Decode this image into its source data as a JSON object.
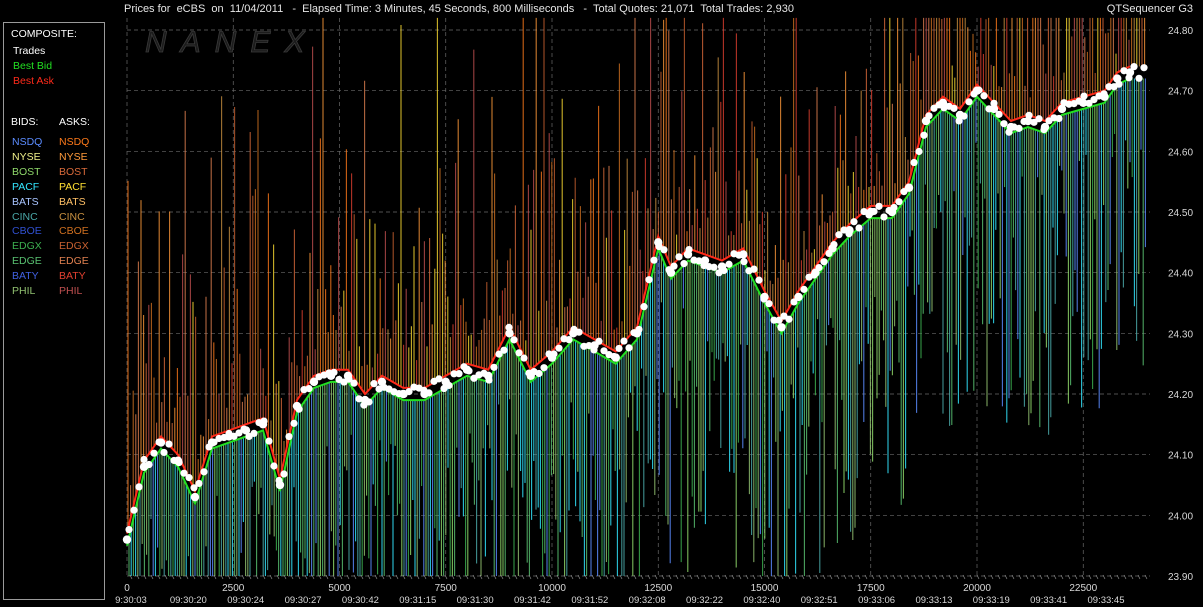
{
  "header": {
    "title": "Prices for  eCBS  on  11/04/2011   -  Elapsed Time: 3 Minutes, 45 Seconds, 800 Milliseconds   -  Total Quotes: 21,071  Total Trades: 2,930",
    "product": "QTSequencer G3",
    "watermark": "NANEX"
  },
  "legend": {
    "composite_title": "COMPOSITE:",
    "composite": [
      {
        "label": "Trades",
        "color": "#ffffff"
      },
      {
        "label": "Best Bid",
        "color": "#22e022"
      },
      {
        "label": "Best Ask",
        "color": "#ff2a1a"
      }
    ],
    "bids_title": "BIDS:",
    "asks_title": "ASKS:",
    "exchanges": [
      {
        "bid": "NSDQ",
        "ask": "NSDQ",
        "bid_color": "#5b8cff",
        "ask_color": "#ff7a1a"
      },
      {
        "bid": "NYSE",
        "ask": "NYSE",
        "bid_color": "#f0f08a",
        "ask_color": "#ff9a3a"
      },
      {
        "bid": "BOST",
        "ask": "BOST",
        "bid_color": "#8fd86a",
        "ask_color": "#d96a3a"
      },
      {
        "bid": "PACF",
        "ask": "PACF",
        "bid_color": "#33e6ff",
        "ask_color": "#ffe033"
      },
      {
        "bid": "BATS",
        "ask": "BATS",
        "bid_color": "#a8c4ff",
        "ask_color": "#ffc066"
      },
      {
        "bid": "CINC",
        "ask": "CINC",
        "bid_color": "#4aa8a8",
        "ask_color": "#c89040"
      },
      {
        "bid": "CBOE",
        "ask": "CBOE",
        "bid_color": "#3050d0",
        "ask_color": "#d07020"
      },
      {
        "bid": "EDGX",
        "ask": "EDGX",
        "bid_color": "#3cb050",
        "ask_color": "#c86030"
      },
      {
        "bid": "EDGE",
        "ask": "EDGE",
        "bid_color": "#58c070",
        "ask_color": "#e08050"
      },
      {
        "bid": "BATY",
        "ask": "BATY",
        "bid_color": "#4060e0",
        "ask_color": "#e04030"
      },
      {
        "bid": "PHIL",
        "ask": "PHIL",
        "bid_color": "#90c070",
        "ask_color": "#c05050"
      }
    ]
  },
  "chart_data": {
    "type": "line",
    "title": "Prices for  eCBS  on  11/04/2011",
    "ylim": [
      23.9,
      24.8
    ],
    "y_ticks": [
      "24.80",
      "24.70",
      "24.60",
      "24.50",
      "24.40",
      "24.30",
      "24.20",
      "24.10",
      "24.00",
      "23.90"
    ],
    "xlim": [
      0,
      24000
    ],
    "x_ticks": [
      "0",
      "2500",
      "5000",
      "7500",
      "10000",
      "12500",
      "15000",
      "17500",
      "20000",
      "22500"
    ],
    "time_ticks": [
      "9:30:03",
      "09:30:20",
      "09:30:24",
      "09:30:27",
      "09:30:42",
      "09:31:15",
      "09:31:30",
      "09:31:42",
      "09:31:52",
      "09:32:08",
      "09:32:22",
      "09:32:40",
      "09:32:51",
      "09:33:06",
      "09:33:13",
      "09:33:19",
      "09:33:41",
      "09:33:45"
    ],
    "grid": true,
    "series": [
      {
        "name": "Trades",
        "color": "#ffffff",
        "x": [
          0,
          400,
          800,
          1200,
          1600,
          2000,
          2400,
          2800,
          3200,
          3600,
          4000,
          4400,
          4800,
          5200,
          5600,
          6000,
          6500,
          7000,
          7500,
          8000,
          8500,
          9000,
          9500,
          10000,
          10500,
          11000,
          11500,
          12000,
          12500,
          12800,
          13200,
          13600,
          14000,
          14500,
          15000,
          15400,
          15800,
          16200,
          16600,
          17000,
          17500,
          18000,
          18400,
          18800,
          19200,
          19600,
          20000,
          20400,
          20800,
          21200,
          21600,
          22000,
          22500,
          23000,
          23300,
          23600
        ],
        "y": [
          23.96,
          24.08,
          24.12,
          24.09,
          24.03,
          24.12,
          24.13,
          24.14,
          24.15,
          24.05,
          24.18,
          24.22,
          24.23,
          24.23,
          24.19,
          24.22,
          24.2,
          24.2,
          24.22,
          24.24,
          24.23,
          24.3,
          24.23,
          24.26,
          24.3,
          24.28,
          24.26,
          24.3,
          24.45,
          24.4,
          24.43,
          24.42,
          24.41,
          24.43,
          24.36,
          24.31,
          24.36,
          24.4,
          24.44,
          24.47,
          24.5,
          24.5,
          24.54,
          24.65,
          24.68,
          24.66,
          24.7,
          24.67,
          24.64,
          24.65,
          24.64,
          24.67,
          24.68,
          24.69,
          24.72,
          24.73
        ]
      },
      {
        "name": "Best Bid",
        "color": "#22e022",
        "y_offset": -0.01
      },
      {
        "name": "Best Ask",
        "color": "#ff2a1a",
        "y_offset": 0.01
      }
    ]
  }
}
